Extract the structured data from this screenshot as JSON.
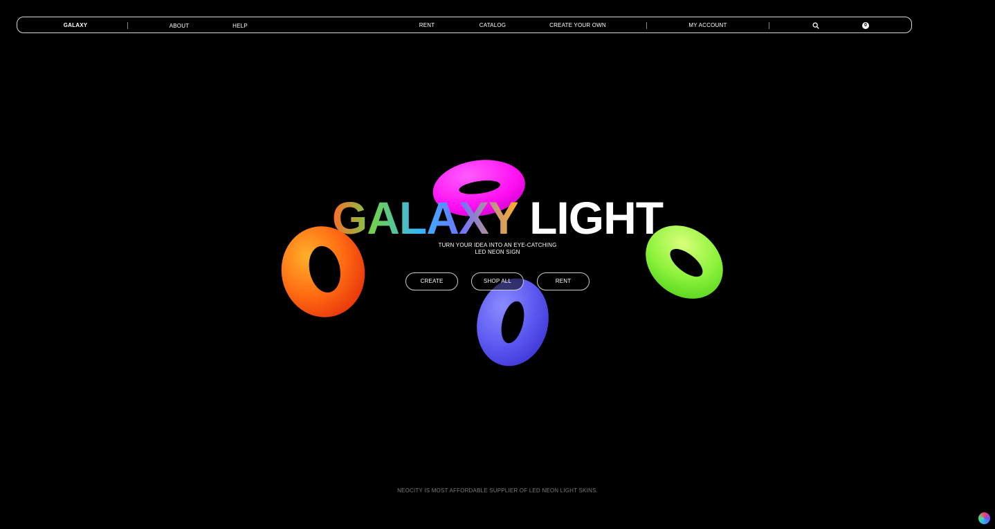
{
  "nav": {
    "logo": "GALAXY",
    "left_links": [
      "ABOUT",
      "HELP"
    ],
    "center_links": [
      "RENT",
      "CATALOG",
      "CREATE YOUR OWN"
    ],
    "account_label": "MY ACCOUNT",
    "search_icon": "search-icon",
    "cart_count": "0"
  },
  "hero": {
    "title_part_1": "GALAXY",
    "title_part_2": "LIGHT",
    "subtitle_line_1": "TURN YOUR IDEA INTO AN EYE-CATCHING",
    "subtitle_line_2": "LED NEON SIGN",
    "buttons": [
      "CREATE",
      "SHOP ALL",
      "RENT"
    ]
  },
  "decor": {
    "torus_colors": [
      "#ff5a14",
      "#ff12f0",
      "#5a58f0",
      "#8cf23a"
    ]
  },
  "footer": {
    "note": "NEOCITY IS MOST AFFORDABLE SUPPLIER OF LED NEON LIGHT SKINS."
  }
}
